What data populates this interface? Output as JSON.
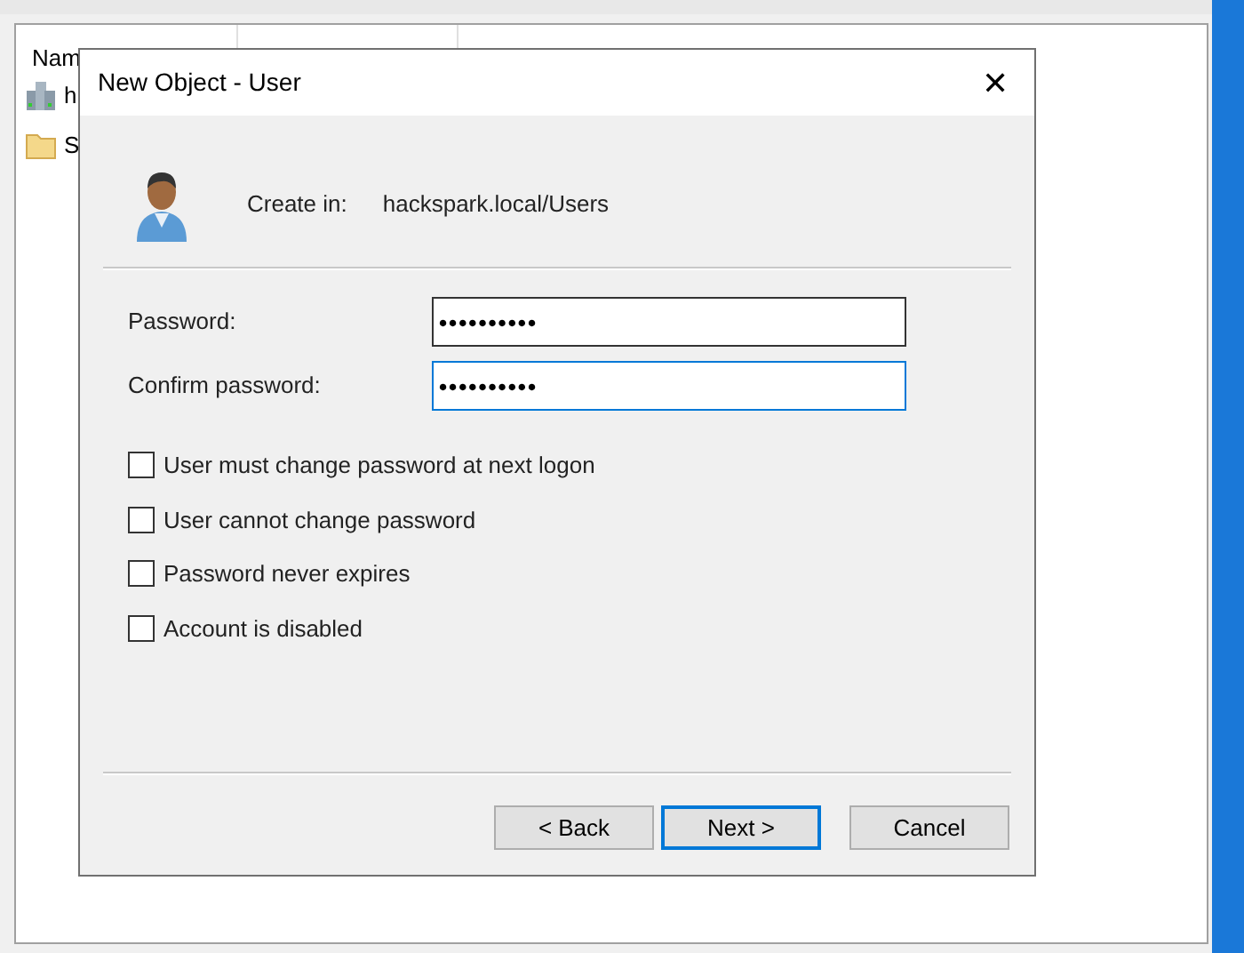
{
  "background_window": {
    "columns": [
      {
        "label": "Nam"
      }
    ],
    "items": [
      {
        "kind": "domain",
        "label": "h"
      },
      {
        "kind": "folder",
        "label": "S"
      }
    ]
  },
  "dialog": {
    "title": "New Object - User",
    "close": "✕",
    "create_in_label": "Create in:",
    "create_in_value": "hackspark.local/Users",
    "fields": [
      {
        "label": "Password:",
        "value": "••••••••••",
        "focused": false
      },
      {
        "label": "Confirm password:",
        "value": "••••••••••",
        "focused": true
      }
    ],
    "options": [
      {
        "label": "User must change password at next logon",
        "checked": false
      },
      {
        "label": "User cannot change password",
        "checked": false
      },
      {
        "label": "Password never expires",
        "checked": false
      },
      {
        "label": "Account is disabled",
        "checked": false
      }
    ],
    "buttons": [
      {
        "label": "< Back",
        "default": false
      },
      {
        "label": "Next >",
        "default": true
      },
      {
        "label": "Cancel",
        "default": false
      }
    ]
  }
}
